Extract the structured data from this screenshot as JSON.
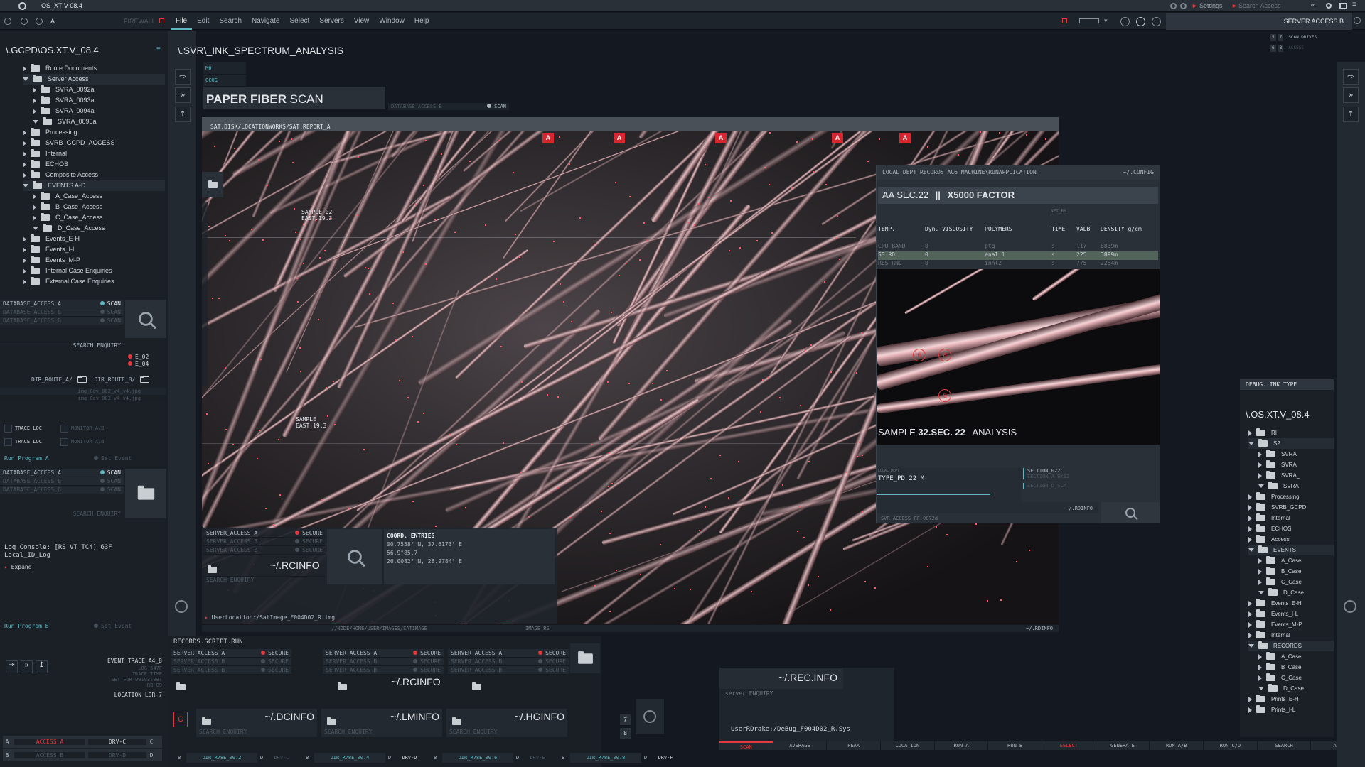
{
  "titlebar": {
    "title": "OS_XT V-08.4",
    "settings": "Settings",
    "search_access": "Search Access"
  },
  "toolbar": {
    "firewall": "FIREWALL",
    "a_label": "A",
    "server_access": "SERVER ACCESS B"
  },
  "menu": [
    "File",
    "Edit",
    "Search",
    "Navigate",
    "Select",
    "Servers",
    "View",
    "Window",
    "Help"
  ],
  "left": {
    "path": "\\.GCPD\\OS.XT.V_08.4",
    "tree": [
      {
        "label": "Route Documents",
        "lvl": 0,
        "open": false
      },
      {
        "label": "Server Access",
        "lvl": 0,
        "open": true
      },
      {
        "label": "SVRA_0092a",
        "lvl": 1,
        "open": false
      },
      {
        "label": "SVRA_0093a",
        "lvl": 1,
        "open": false
      },
      {
        "label": "SVRA_0094a",
        "lvl": 1,
        "open": false
      },
      {
        "label": "SVRA_0095a",
        "lvl": 1,
        "open": true
      },
      {
        "label": "Processing",
        "lvl": 0,
        "open": false
      },
      {
        "label": "SVRB_GCPD_ACCESS",
        "lvl": 0,
        "open": false
      },
      {
        "label": "Internal",
        "lvl": 0,
        "open": false
      },
      {
        "label": "ECHOS",
        "lvl": 0,
        "open": false
      },
      {
        "label": "Composite Access",
        "lvl": 0,
        "open": false
      },
      {
        "label": "EVENTS A-D",
        "lvl": 0,
        "open": true
      },
      {
        "label": "A_Case_Access",
        "lvl": 1,
        "open": false
      },
      {
        "label": "B_Case_Access",
        "lvl": 1,
        "open": false
      },
      {
        "label": "C_Case_Access",
        "lvl": 1,
        "open": false
      },
      {
        "label": "D_Case_Access",
        "lvl": 1,
        "open": true
      },
      {
        "label": "Events_E-H",
        "lvl": 0,
        "open": false
      },
      {
        "label": "Events_I-L",
        "lvl": 0,
        "open": false
      },
      {
        "label": "Events_M-P",
        "lvl": 0,
        "open": false
      },
      {
        "label": "Internal  Case Enquiries",
        "lvl": 0,
        "open": false
      },
      {
        "label": "External Case Enquiries",
        "lvl": 0,
        "open": false
      }
    ],
    "db1": [
      "DATABASE_ACCESS A",
      "DATABASE_ACCESS B",
      "DATABASE_ACCESS B"
    ],
    "scan": "SCAN",
    "search_enquiry": "SEARCH ENQUIRY",
    "e02": "E_02",
    "e04": "E_04",
    "dir_a": "DIR_ROUTE_A/",
    "dir_b": "DIR_ROUTE_B/",
    "img1": "img_Gdv_002_v4_v4.jpg",
    "img2": "img_Gdv_003_v4_v4.jpg",
    "trace": "TRACE LOC",
    "monitor": "MONITOR A/B",
    "run_a": "Run Program A",
    "run_b": "Run Program B",
    "set_event": "Set Event",
    "db2": [
      "DATABASE_ACCESS A",
      "DATABASE_ACCESS B",
      "DATABASE_ACCESS B"
    ],
    "log1": "Log Console: [RS_VT_TC4]_63F",
    "log2": "Local_ID_Log",
    "expand": "Expand",
    "event_trace": "EVENT TRACE A4_8",
    "trace_info": [
      "LOG 647F",
      "TRACE TIME",
      "SET FOR 00:03:09T",
      "RB-09"
    ],
    "location": "LOCATION  LDR-7",
    "access_a": "ACCESS A",
    "access_b": "ACCESS B",
    "drv_c": "DRV-C",
    "drv_d": "DRV-D"
  },
  "main": {
    "path": "\\.SVR\\_INK_SPECTRUM_ANALYSIS",
    "mini_tabs": [
      "M6",
      "GCHG"
    ],
    "title_bold": "PAPER FIBER",
    "title_light": "SCAN",
    "db_access": "DATABASE_ACCESS B",
    "scan": "SCAN",
    "image_path": "SAT.DISK/LOCATIONWORKS/SAT.REPORT_A",
    "sample1": [
      "SAMPLE 02",
      "EAST.19.3"
    ],
    "sample2": [
      "SAMPLE",
      "EAST.19.3"
    ],
    "markers": [
      "A",
      "A",
      "A",
      "A",
      "A"
    ],
    "rcinfo": "~/.RCINFO",
    "search_enquiry": "SEARCH ENQUIRY",
    "server_rows": [
      "SERVER_ACCESS A",
      "SERVER_ACCESS B",
      "SERVER_ACCESS B"
    ],
    "secure": "SECURE",
    "coord_title": "COORD. ENTRIES",
    "coords": [
      "00.7558° N, 37.6173° E",
      "56.9°85.7",
      "26.0082° N, 28.9784° E"
    ],
    "user_location": "UserLocation:/SatImage_F004D02_R.img",
    "node_path": "//NODE/HOME/USER/IMAGES/SATIMAGE",
    "image_rs": "IMAGE_RS",
    "rdinfo": "~/.RDINFO"
  },
  "analysis": {
    "path": "LOCAL_DEPT_RECORDS_AC6_MACHINE\\RUNAPPLICATION",
    "config": "~/.CONFIG",
    "heading_a": "AA SEC.22",
    "heading_b": "X5000 FACTOR",
    "net": "NET_RS",
    "cols": [
      "TEMP.",
      "Dyn. VISCOSITY",
      "POLYMERS",
      "TIME",
      "VALB",
      "DENSITY g/cm"
    ],
    "rows": [
      [
        "CPU BAND",
        "0",
        "ptg",
        "s",
        "l17",
        "8839m"
      ],
      [
        "SS RD",
        "0",
        "enal l",
        "s",
        "225",
        "3899m"
      ],
      [
        "RES RNG",
        "0",
        "inhl2",
        "s",
        "775",
        "2284m"
      ]
    ],
    "circles": [
      "6",
      "6",
      "6"
    ],
    "sample_a": "SAMPLE",
    "sample_b": "32.SEC. 22",
    "sample_c": "ANALYSIS",
    "local_dept": "LOCAL_DEPT",
    "type": "TYPE_PD 22 M",
    "section": "SECTION_022",
    "section_sub": "SECTION_A_9X12",
    "section2": "SECTION_D_SLM",
    "rdinfo": "~/.RDINFO",
    "svr": "SVR_ACCESS_RF_0072d"
  },
  "records": {
    "title": "RECORDS.SCRIPT.RUN",
    "server_rows": [
      "SERVER_ACCESS A",
      "SERVER_ACCESS B",
      "SERVER_ACCESS B"
    ],
    "secure": "SECURE",
    "rcinfo": "~/.RCINFO",
    "dcinfo": "~/.DCINFO",
    "lminfo": "~/.LMINFO",
    "hginfo": "~/.HGINFO",
    "search_enquiry": "SEARCH ENQUIRY",
    "dirs": [
      "DIR_R78E_00.2",
      "DIR_R78E_00.4",
      "DIR_R78E_00.6",
      "DIR_R78E_00.8"
    ],
    "drv": [
      "DRV-C",
      "DRV-D",
      "DRV-E",
      "DRV-F"
    ],
    "small": [
      "7",
      "8"
    ]
  },
  "rec": {
    "recinfo": "~/.REC.INFO",
    "server_enq": "server ENQUIRY",
    "user": "UserRDrake:/DeBug_F004D02_R.Sys"
  },
  "bottom_tabs": [
    "SCAN",
    "AVERAGE",
    "PEAK",
    "LOCATION",
    "RUN A",
    "RUN B",
    "SELECT",
    "GENERATE",
    "RUN A/B",
    "RUN C/D",
    "SEARCH",
    "AUX"
  ],
  "right": {
    "scan_drives": "SCAN DRIVES",
    "access": "ACCESS",
    "rn": [
      "5",
      "7",
      "6",
      "8"
    ],
    "debug": "DEBUG. INK TYPE",
    "path": "\\.OS.XT.V_08.4",
    "tree": [
      {
        "label": "RI",
        "lvl": 0,
        "open": false
      },
      {
        "label": "S2",
        "lvl": 0,
        "open": true
      },
      {
        "label": "SVRA",
        "lvl": 1,
        "open": false
      },
      {
        "label": "SVRA",
        "lvl": 1,
        "open": false
      },
      {
        "label": "SVRA_",
        "lvl": 1,
        "open": false
      },
      {
        "label": "SVRA",
        "lvl": 1,
        "open": true
      },
      {
        "label": "Processing",
        "lvl": 0,
        "open": false
      },
      {
        "label": "SVRB_GCPD",
        "lvl": 0,
        "open": false
      },
      {
        "label": "Internal",
        "lvl": 0,
        "open": false
      },
      {
        "label": "ECHOS",
        "lvl": 0,
        "open": false
      },
      {
        "label": "Access",
        "lvl": 0,
        "open": false
      },
      {
        "label": "EVENTS",
        "lvl": 0,
        "open": true
      },
      {
        "label": "A_Case",
        "lvl": 1,
        "open": false
      },
      {
        "label": "B_Case",
        "lvl": 1,
        "open": false
      },
      {
        "label": "C_Case",
        "lvl": 1,
        "open": false
      },
      {
        "label": "D_Case",
        "lvl": 1,
        "open": true
      },
      {
        "label": "Events_E-H",
        "lvl": 0,
        "open": false
      },
      {
        "label": "Events_I-L",
        "lvl": 0,
        "open": false
      },
      {
        "label": "Events_M-P",
        "lvl": 0,
        "open": false
      },
      {
        "label": "Internal",
        "lvl": 0,
        "open": false
      },
      {
        "label": "RECORDS",
        "lvl": 0,
        "open": true
      },
      {
        "label": "A_Case",
        "lvl": 1,
        "open": false
      },
      {
        "label": "B_Case",
        "lvl": 1,
        "open": false
      },
      {
        "label": "C_Case",
        "lvl": 1,
        "open": false
      },
      {
        "label": "D_Case",
        "lvl": 1,
        "open": true
      },
      {
        "label": "Prints_E-H",
        "lvl": 0,
        "open": false
      },
      {
        "label": "Prints_I-L",
        "lvl": 0,
        "open": false
      }
    ]
  },
  "colors": {
    "accent": "#5fb7c0",
    "alert": "#e0393e",
    "panel": "#232930",
    "bg": "#141820"
  }
}
